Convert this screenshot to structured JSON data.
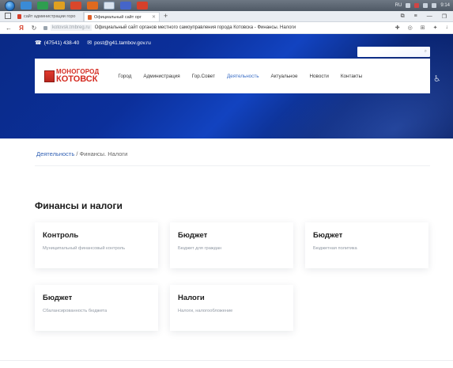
{
  "taskbar": {
    "tray_lang": "RU",
    "tray_time": "9:14"
  },
  "browser": {
    "tabs": [
      {
        "label": "сайт администрации горо",
        "active": false
      },
      {
        "label": "Официальный сайт орг",
        "active": true
      }
    ],
    "new_tab": "+",
    "domain": "kotovsk.tmbreg.ru",
    "page_title": "Официальный сайт органов местного самоуправления города Котовска - Финансы. Налоги"
  },
  "site": {
    "phone": "(47541) 438-40",
    "email": "post@g41.tambov.gov.ru",
    "logo_line1": "МОНОГОРОД",
    "logo_line2": "КОТОВСК",
    "menu": [
      {
        "label": "Город",
        "current": false
      },
      {
        "label": "Администрация",
        "current": false
      },
      {
        "label": "Гор.Совет",
        "current": false
      },
      {
        "label": "Деятельность",
        "current": true
      },
      {
        "label": "Актуальное",
        "current": false
      },
      {
        "label": "Новости",
        "current": false
      },
      {
        "label": "Контакты",
        "current": false
      }
    ]
  },
  "breadcrumb": {
    "link": "Деятельность",
    "separator": " / ",
    "current": "Финансы. Налоги"
  },
  "section": {
    "title": "Финансы и налоги"
  },
  "cards": [
    {
      "title": "Контроль",
      "subtitle": "Муниципальный финансовый контроль"
    },
    {
      "title": "Бюджет",
      "subtitle": "Бюджет для граждан"
    },
    {
      "title": "Бюджет",
      "subtitle": "Бюджетная политика"
    },
    {
      "title": "Бюджет",
      "subtitle": "Сбалансированность бюджета"
    },
    {
      "title": "Налоги",
      "subtitle": "Налоги, налогообложение"
    }
  ],
  "colors": {
    "accent_link": "#2f5fb3",
    "logo_red": "#d42a20",
    "hero_blue": "#0b2f9a"
  }
}
